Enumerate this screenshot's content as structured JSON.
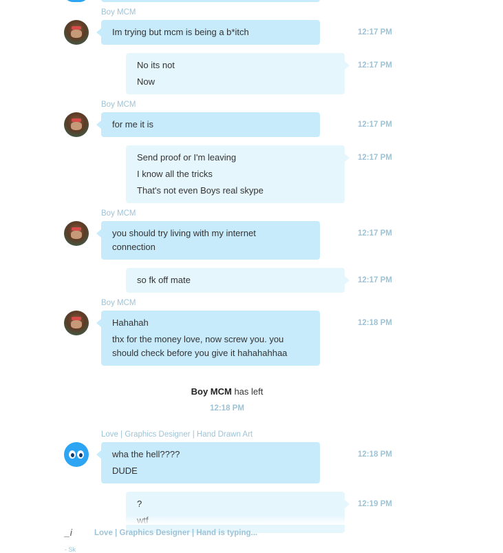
{
  "chat": {
    "partial_bottom_text": "- Sk",
    "messages": [
      {
        "sender": "Boy MCM",
        "time": "12:17 PM",
        "lines": [
          "Im trying but mcm is being a b*itch"
        ]
      },
      {
        "time": "12:17 PM",
        "lines": [
          "No its not",
          "Now"
        ]
      },
      {
        "sender": "Boy MCM",
        "time": "12:17 PM",
        "lines": [
          "for me it is"
        ]
      },
      {
        "time": "12:17 PM",
        "lines": [
          "Send proof or I'm leaving",
          "I know all the tricks",
          "That's not even Boys real skype"
        ]
      },
      {
        "sender": "Boy MCM",
        "time": "12:17 PM",
        "lines": [
          "you should try living with my internet",
          "connection"
        ]
      },
      {
        "time": "12:17 PM",
        "lines": [
          "so fk off mate"
        ]
      },
      {
        "sender": "Boy MCM",
        "time": "12:18 PM",
        "lines": [
          "Hahahah",
          "thx for the money love, now screw you. you",
          "should check before you give it hahahahhaa"
        ]
      },
      {
        "sender": "Love | Graphics Designer | Hand Drawn Art",
        "time": "12:18 PM",
        "lines": [
          "wha the hell????",
          "DUDE"
        ]
      },
      {
        "time": "12:19 PM",
        "lines": [
          "?",
          "wtf"
        ]
      }
    ],
    "system_event": {
      "name": "Boy MCM",
      "text": "has left",
      "time": "12:18 PM"
    },
    "typing_indicator": {
      "icon": "pencil-icon",
      "text": "Love | Graphics Designer | Hand is typing...",
      "glyph": "_i"
    }
  },
  "colors": {
    "incoming_bubble": "#c7ebfb",
    "outgoing_bubble": "#e6f6fd",
    "timestamp": "#9ec3d6"
  }
}
